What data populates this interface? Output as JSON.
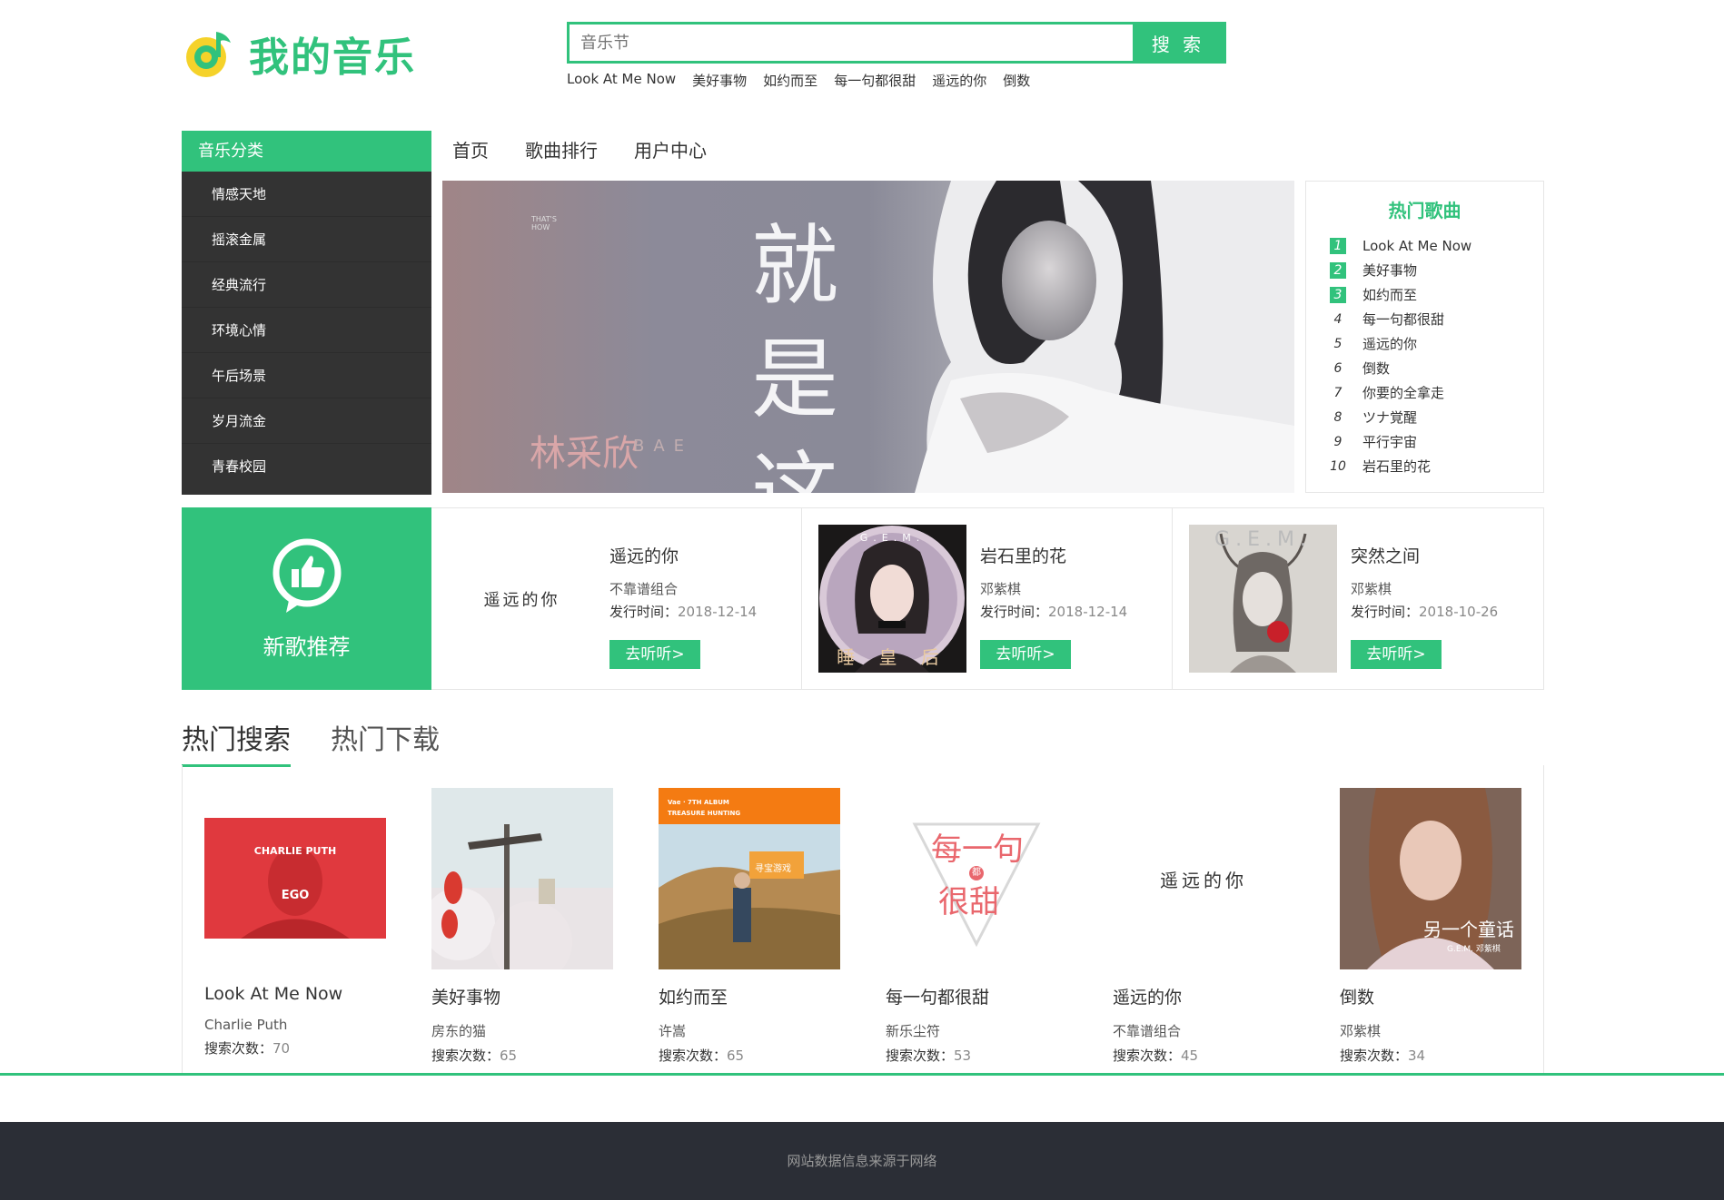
{
  "brand": {
    "name": "我的音乐",
    "accent": "#31c27c"
  },
  "search": {
    "placeholder": "音乐节",
    "button": "搜 索",
    "keywords": [
      "Look At Me Now",
      "美好事物",
      "如约而至",
      "每一句都很甜",
      "遥远的你",
      "倒数"
    ]
  },
  "categories": {
    "title": "音乐分类",
    "items": [
      "情感天地",
      "摇滚金属",
      "经典流行",
      "环境心情",
      "午后场景",
      "岁月流金",
      "青春校园"
    ]
  },
  "nav": [
    "首页",
    "歌曲排行",
    "用户中心"
  ],
  "banner": {
    "title_line1": "就是",
    "title_line2": "这样",
    "artist": "林采欣",
    "artist_en": "BAE",
    "small_text": "THAT'S HOW"
  },
  "hot_songs": {
    "title": "热门歌曲",
    "items": [
      {
        "rank": "1",
        "name": "Look At Me Now"
      },
      {
        "rank": "2",
        "name": "美好事物"
      },
      {
        "rank": "3",
        "name": "如约而至"
      },
      {
        "rank": "4",
        "name": "每一句都很甜"
      },
      {
        "rank": "5",
        "name": "遥远的你"
      },
      {
        "rank": "6",
        "name": "倒数"
      },
      {
        "rank": "7",
        "name": "你要的全拿走"
      },
      {
        "rank": "8",
        "name": "ツナ覚醒"
      },
      {
        "rank": "9",
        "name": "平行宇宙"
      },
      {
        "rank": "10",
        "name": "岩石里的花"
      }
    ]
  },
  "new_songs": {
    "label": "新歌推荐",
    "date_label": "发行时间：",
    "listen_label": "去听听>",
    "items": [
      {
        "name": "遥远的你",
        "artist": "不靠谱组合",
        "date": "2018-12-14",
        "cover_text": "遥远的你"
      },
      {
        "name": "岩石里的花",
        "artist": "邓紫棋",
        "date": "2018-12-14",
        "cover_text_top": "G.E.M.",
        "cover_text_bottom": "睡 皇 后"
      },
      {
        "name": "突然之间",
        "artist": "邓紫棋",
        "date": "2018-10-26",
        "cover_text": "G.E.M."
      }
    ]
  },
  "tabs": [
    "热门搜索",
    "热门下载"
  ],
  "hot_search": {
    "count_label": "搜索次数：",
    "items": [
      {
        "name": "Look At Me Now",
        "artist": "Charlie Puth",
        "count": "70",
        "cover_text_top": "CHARLIE PUTH",
        "cover_text_bottom": "EGO"
      },
      {
        "name": "美好事物",
        "artist": "房东的猫",
        "count": "65"
      },
      {
        "name": "如约而至",
        "artist": "许嵩",
        "count": "65",
        "cover_text_top": "Vae · 7TH ALBUM",
        "cover_text_sub": "TREASURE HUNTING",
        "cover_sign": "寻宝游戏"
      },
      {
        "name": "每一句都很甜",
        "artist": "新乐尘符",
        "count": "53",
        "cover_text_top": "每一句",
        "cover_text_bottom": "很甜",
        "cover_text_mid": "都"
      },
      {
        "name": "遥远的你",
        "artist": "不靠谱组合",
        "count": "45",
        "cover_text": "遥远的你"
      },
      {
        "name": "倒数",
        "artist": "邓紫棋",
        "count": "34",
        "cover_text": "另一个童话",
        "cover_sub": "G.E.M. 邓紫棋"
      }
    ]
  },
  "footer": "网站数据信息来源于网络"
}
